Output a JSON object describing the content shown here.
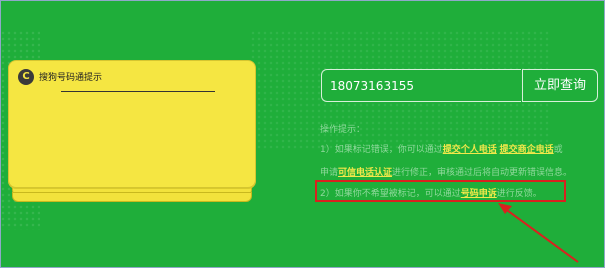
{
  "card": {
    "icon_glyph": "C",
    "title": "搜狗号码通提示"
  },
  "search": {
    "phone_value": "18073163155",
    "button_label": "立即查询"
  },
  "tips": {
    "heading": "操作提示：",
    "line1_prefix": "1）如果标记错误，你可以通过",
    "link_personal": "提交个人电话",
    "link_enterprise": "提交商企电话",
    "line1_suffix": "或",
    "line2_prefix": "申请",
    "link_trusted": "可信电话认证",
    "line2_suffix": "进行修正，审核通过后将自动更新错误信息。",
    "line3_prefix": "2）如果你不希望被标记，可以通过",
    "link_appeal": "号码申诉",
    "line3_suffix": "进行反馈。"
  },
  "annotation": {
    "box_color": "#d9211f"
  },
  "colors": {
    "background": "#1fae3a",
    "card": "#f5e642",
    "link": "#f3e84a"
  }
}
